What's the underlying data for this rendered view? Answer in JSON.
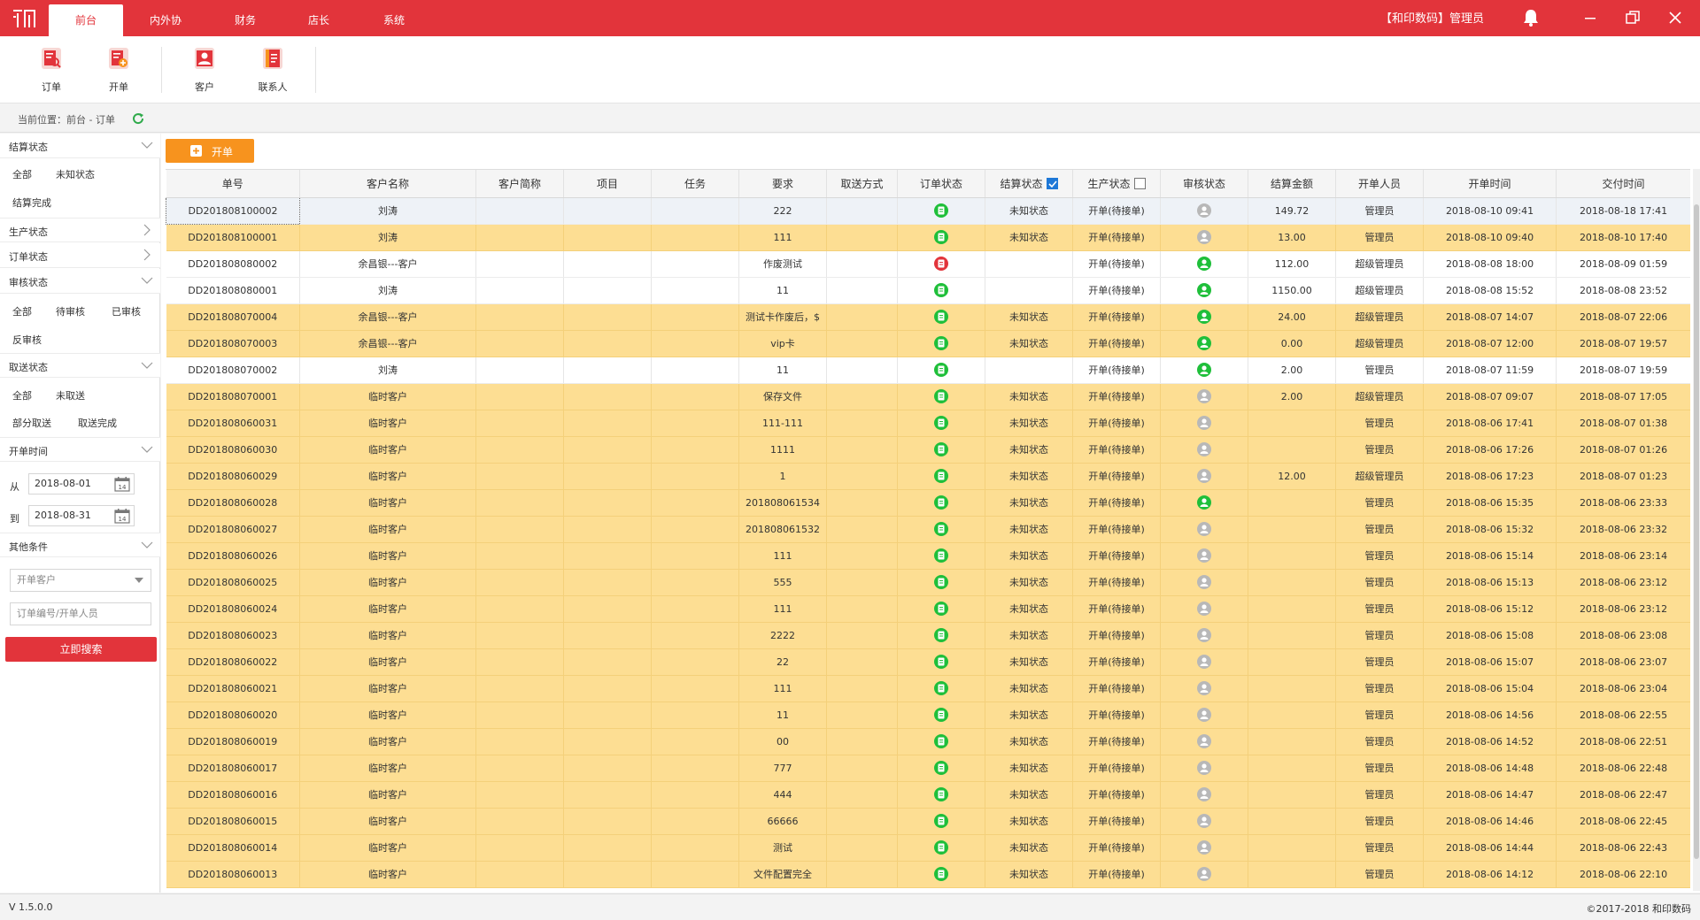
{
  "titlebar": {
    "tabs": [
      "前台",
      "内外协",
      "财务",
      "店长",
      "系统"
    ],
    "active_tab": "前台",
    "user": "【和印数码】管理员",
    "color": "#e2343b"
  },
  "toolbar": {
    "items": [
      "订单",
      "开单",
      "客户",
      "联系人"
    ]
  },
  "breadcrumb": "当前位置：前台 - 订单",
  "sidebar": {
    "sections": {
      "settle": "结算状态",
      "production": "生产状态",
      "order": "订单状态",
      "audit": "审核状态",
      "delivery": "取送状态",
      "open_time": "开单时间",
      "other": "其他条件"
    },
    "settle_opts": [
      "全部",
      "未知状态",
      "结算完成"
    ],
    "audit_opts": [
      "全部",
      "待审核",
      "已审核",
      "反审核"
    ],
    "delivery_opts": [
      "全部",
      "未取送",
      "部分取送",
      "取送完成"
    ],
    "date_from_label": "从",
    "date_to_label": "到",
    "date_from": "2018-08-01",
    "date_to": "2018-08-31",
    "customer_placeholder": "开单客户",
    "keyword_placeholder": "订单编号/开单人员",
    "search_button": "立即搜索"
  },
  "main": {
    "open_button": "开单",
    "columns": [
      "单号",
      "客户名称",
      "客户简称",
      "项目",
      "任务",
      "要求",
      "取送方式",
      "订单状态",
      "结算状态",
      "生产状态",
      "审核状态",
      "结算金额",
      "开单人员",
      "开单时间",
      "交付时间"
    ],
    "settle_checkbox_checked": true,
    "production_checkbox_checked": false,
    "rows": [
      {
        "no": "DD201808100002",
        "customer": "刘涛",
        "req": "222",
        "order_status": "green",
        "settle": "未知状态",
        "prod": "开单(待接单)",
        "audit": "grey",
        "amount": "149.72",
        "staff": "管理员",
        "open": "2018-08-10 09:41",
        "due": "2018-08-18 17:41",
        "style": "first"
      },
      {
        "no": "DD201808100001",
        "customer": "刘涛",
        "req": "111",
        "order_status": "green",
        "settle": "未知状态",
        "prod": "开单(待接单)",
        "audit": "grey",
        "amount": "13.00",
        "staff": "管理员",
        "open": "2018-08-10 09:40",
        "due": "2018-08-10 17:40",
        "style": "hl"
      },
      {
        "no": "DD201808080002",
        "customer": "余昌银---客户",
        "req": "作废测试",
        "order_status": "red",
        "settle": "",
        "prod": "开单(待接单)",
        "audit": "green",
        "amount": "112.00",
        "staff": "超级管理员",
        "open": "2018-08-08 18:00",
        "due": "2018-08-09 01:59",
        "style": "wh"
      },
      {
        "no": "DD201808080001",
        "customer": "刘涛",
        "req": "11",
        "order_status": "green",
        "settle": "",
        "prod": "开单(待接单)",
        "audit": "green",
        "amount": "1150.00",
        "staff": "超级管理员",
        "open": "2018-08-08 15:52",
        "due": "2018-08-08 23:52",
        "style": "wh"
      },
      {
        "no": "DD201808070004",
        "customer": "余昌银---客户",
        "req": "测试卡作废后，$",
        "order_status": "green",
        "settle": "未知状态",
        "prod": "开单(待接单)",
        "audit": "green",
        "amount": "24.00",
        "staff": "超级管理员",
        "open": "2018-08-07 14:07",
        "due": "2018-08-07 22:06",
        "style": "hl"
      },
      {
        "no": "DD201808070003",
        "customer": "余昌银---客户",
        "req": "vip卡",
        "order_status": "green",
        "settle": "未知状态",
        "prod": "开单(待接单)",
        "audit": "green",
        "amount": "0.00",
        "staff": "超级管理员",
        "open": "2018-08-07 12:00",
        "due": "2018-08-07 19:57",
        "style": "hl"
      },
      {
        "no": "DD201808070002",
        "customer": "刘涛",
        "req": "11",
        "order_status": "green",
        "settle": "",
        "prod": "开单(待接单)",
        "audit": "green",
        "amount": "2.00",
        "staff": "管理员",
        "open": "2018-08-07 11:59",
        "due": "2018-08-07 19:59",
        "style": "wh"
      },
      {
        "no": "DD201808070001",
        "customer": "临时客户",
        "req": "保存文件",
        "order_status": "green",
        "settle": "未知状态",
        "prod": "开单(待接单)",
        "audit": "grey",
        "amount": "2.00",
        "staff": "超级管理员",
        "open": "2018-08-07 09:07",
        "due": "2018-08-07 17:05",
        "style": "hl"
      },
      {
        "no": "DD201808060031",
        "customer": "临时客户",
        "req": "111-111",
        "order_status": "green",
        "settle": "未知状态",
        "prod": "开单(待接单)",
        "audit": "grey",
        "amount": "",
        "staff": "管理员",
        "open": "2018-08-06 17:41",
        "due": "2018-08-07 01:38",
        "style": "hl"
      },
      {
        "no": "DD201808060030",
        "customer": "临时客户",
        "req": "1111",
        "order_status": "green",
        "settle": "未知状态",
        "prod": "开单(待接单)",
        "audit": "grey",
        "amount": "",
        "staff": "管理员",
        "open": "2018-08-06 17:26",
        "due": "2018-08-07 01:26",
        "style": "hl"
      },
      {
        "no": "DD201808060029",
        "customer": "临时客户",
        "req": "1",
        "order_status": "green",
        "settle": "未知状态",
        "prod": "开单(待接单)",
        "audit": "grey",
        "amount": "12.00",
        "staff": "超级管理员",
        "open": "2018-08-06 17:23",
        "due": "2018-08-07 01:23",
        "style": "hl"
      },
      {
        "no": "DD201808060028",
        "customer": "临时客户",
        "req": "201808061534",
        "order_status": "green",
        "settle": "未知状态",
        "prod": "开单(待接单)",
        "audit": "green",
        "amount": "",
        "staff": "管理员",
        "open": "2018-08-06 15:35",
        "due": "2018-08-06 23:33",
        "style": "hl"
      },
      {
        "no": "DD201808060027",
        "customer": "临时客户",
        "req": "201808061532",
        "order_status": "green",
        "settle": "未知状态",
        "prod": "开单(待接单)",
        "audit": "grey",
        "amount": "",
        "staff": "管理员",
        "open": "2018-08-06 15:32",
        "due": "2018-08-06 23:32",
        "style": "hl"
      },
      {
        "no": "DD201808060026",
        "customer": "临时客户",
        "req": "111",
        "order_status": "green",
        "settle": "未知状态",
        "prod": "开单(待接单)",
        "audit": "grey",
        "amount": "",
        "staff": "管理员",
        "open": "2018-08-06 15:14",
        "due": "2018-08-06 23:14",
        "style": "hl"
      },
      {
        "no": "DD201808060025",
        "customer": "临时客户",
        "req": "555",
        "order_status": "green",
        "settle": "未知状态",
        "prod": "开单(待接单)",
        "audit": "grey",
        "amount": "",
        "staff": "管理员",
        "open": "2018-08-06 15:13",
        "due": "2018-08-06 23:12",
        "style": "hl"
      },
      {
        "no": "DD201808060024",
        "customer": "临时客户",
        "req": "111",
        "order_status": "green",
        "settle": "未知状态",
        "prod": "开单(待接单)",
        "audit": "grey",
        "amount": "",
        "staff": "管理员",
        "open": "2018-08-06 15:12",
        "due": "2018-08-06 23:12",
        "style": "hl"
      },
      {
        "no": "DD201808060023",
        "customer": "临时客户",
        "req": "2222",
        "order_status": "green",
        "settle": "未知状态",
        "prod": "开单(待接单)",
        "audit": "grey",
        "amount": "",
        "staff": "管理员",
        "open": "2018-08-06 15:08",
        "due": "2018-08-06 23:08",
        "style": "hl"
      },
      {
        "no": "DD201808060022",
        "customer": "临时客户",
        "req": "22",
        "order_status": "green",
        "settle": "未知状态",
        "prod": "开单(待接单)",
        "audit": "grey",
        "amount": "",
        "staff": "管理员",
        "open": "2018-08-06 15:07",
        "due": "2018-08-06 23:07",
        "style": "hl"
      },
      {
        "no": "DD201808060021",
        "customer": "临时客户",
        "req": "111",
        "order_status": "green",
        "settle": "未知状态",
        "prod": "开单(待接单)",
        "audit": "grey",
        "amount": "",
        "staff": "管理员",
        "open": "2018-08-06 15:04",
        "due": "2018-08-06 23:04",
        "style": "hl"
      },
      {
        "no": "DD201808060020",
        "customer": "临时客户",
        "req": "11",
        "order_status": "green",
        "settle": "未知状态",
        "prod": "开单(待接单)",
        "audit": "grey",
        "amount": "",
        "staff": "管理员",
        "open": "2018-08-06 14:56",
        "due": "2018-08-06 22:55",
        "style": "hl"
      },
      {
        "no": "DD201808060019",
        "customer": "临时客户",
        "req": "00",
        "order_status": "green",
        "settle": "未知状态",
        "prod": "开单(待接单)",
        "audit": "grey",
        "amount": "",
        "staff": "管理员",
        "open": "2018-08-06 14:52",
        "due": "2018-08-06 22:51",
        "style": "hl"
      },
      {
        "no": "DD201808060017",
        "customer": "临时客户",
        "req": "777",
        "order_status": "green",
        "settle": "未知状态",
        "prod": "开单(待接单)",
        "audit": "grey",
        "amount": "",
        "staff": "管理员",
        "open": "2018-08-06 14:48",
        "due": "2018-08-06 22:48",
        "style": "hl"
      },
      {
        "no": "DD201808060016",
        "customer": "临时客户",
        "req": "444",
        "order_status": "green",
        "settle": "未知状态",
        "prod": "开单(待接单)",
        "audit": "grey",
        "amount": "",
        "staff": "管理员",
        "open": "2018-08-06 14:47",
        "due": "2018-08-06 22:47",
        "style": "hl"
      },
      {
        "no": "DD201808060015",
        "customer": "临时客户",
        "req": "66666",
        "order_status": "green",
        "settle": "未知状态",
        "prod": "开单(待接单)",
        "audit": "grey",
        "amount": "",
        "staff": "管理员",
        "open": "2018-08-06 14:46",
        "due": "2018-08-06 22:45",
        "style": "hl"
      },
      {
        "no": "DD201808060014",
        "customer": "临时客户",
        "req": "测试",
        "order_status": "green",
        "settle": "未知状态",
        "prod": "开单(待接单)",
        "audit": "grey",
        "amount": "",
        "staff": "管理员",
        "open": "2018-08-06 14:44",
        "due": "2018-08-06 22:43",
        "style": "hl"
      },
      {
        "no": "DD201808060013",
        "customer": "临时客户",
        "req": "文件配置完全",
        "order_status": "green",
        "settle": "未知状态",
        "prod": "开单(待接单)",
        "audit": "grey",
        "amount": "",
        "staff": "管理员",
        "open": "2018-08-06 14:12",
        "due": "2018-08-06 22:10",
        "style": "hl"
      }
    ]
  },
  "statusbar": {
    "version": "V 1.5.0.0",
    "copyright": "©2017-2018 和印数码"
  },
  "icons": {
    "logo": "logo-icon",
    "bell": "bell-icon",
    "minimize": "minimize-icon",
    "restore": "restore-icon",
    "close": "close-icon",
    "refresh": "refresh-icon",
    "calendar": "calendar-icon",
    "chevron": "chevron-icon"
  },
  "colors": {
    "accent": "#e2343b",
    "orange": "#f7931e",
    "row_highlight": "#fdde93",
    "status_green": "#1fbf3a",
    "status_red": "#e2343b",
    "status_grey": "#b8b8b8"
  }
}
